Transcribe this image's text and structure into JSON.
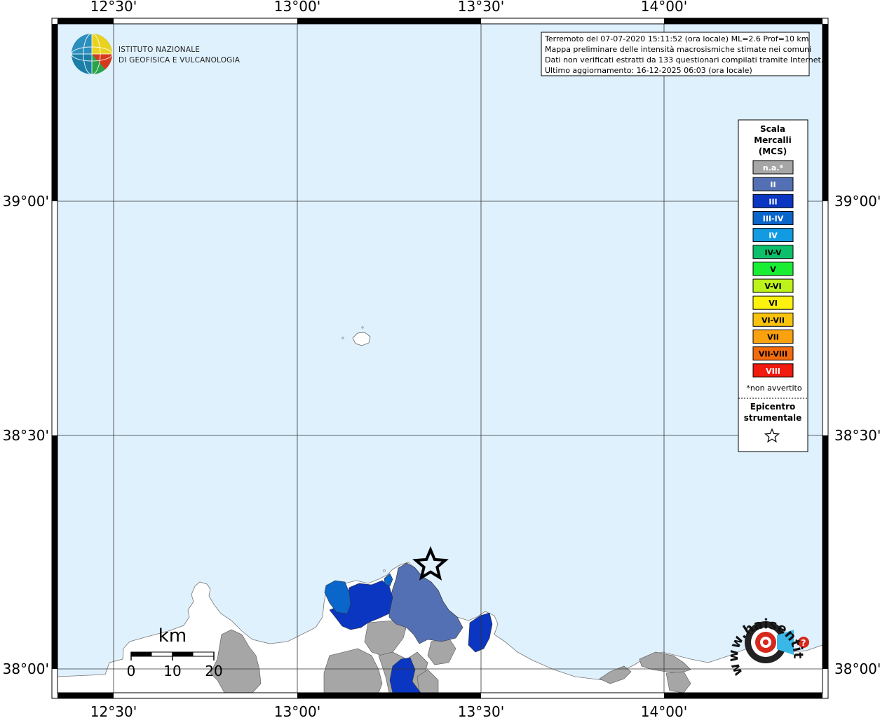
{
  "axes": {
    "top_ticks": [
      "12°30'",
      "13°00'",
      "13°30'",
      "14°00'"
    ],
    "bottom_ticks": [
      "12°30'",
      "13°00'",
      "13°30'",
      "14°00'"
    ],
    "left_ticks": [
      "39°00'",
      "38°30'",
      "38°00'"
    ],
    "right_ticks": [
      "39°00'",
      "38°30'",
      "38°00'"
    ]
  },
  "logo": {
    "line1": "ISTITUTO NAZIONALE",
    "line2": "DI GEOFISICA E VULCANOLOGIA"
  },
  "info_box": {
    "lines": [
      "Terremoto del 07-07-2020 15:11:52 (ora locale) ML=2.6 Prof=10 km",
      "Mappa preliminare delle intensità macrosismiche stimate nei comuni",
      "Dati non verificati estratti da 133 questionari compilati tramite Internet.",
      "Ultimo aggiornamento: 16-12-2025 06:03 (ora locale)"
    ]
  },
  "legend": {
    "title": [
      "Scala",
      "Mercalli",
      "(MCS)"
    ],
    "items": [
      {
        "label": "n.a.*",
        "color": "#a6a6a6",
        "text_color": "#ffffff"
      },
      {
        "label": "II",
        "color": "#5470b4",
        "text_color": "#ffffff"
      },
      {
        "label": "III",
        "color": "#0a36c2",
        "text_color": "#ffffff"
      },
      {
        "label": "III-IV",
        "color": "#0b66cc",
        "text_color": "#ffffff"
      },
      {
        "label": "IV",
        "color": "#129ae3",
        "text_color": "#ffffff"
      },
      {
        "label": "IV-V",
        "color": "#0cbf6a",
        "text_color": "#000000"
      },
      {
        "label": "V",
        "color": "#19ee33",
        "text_color": "#000000"
      },
      {
        "label": "V-VI",
        "color": "#bdf21a",
        "text_color": "#000000"
      },
      {
        "label": "VI",
        "color": "#fbf20e",
        "text_color": "#000000"
      },
      {
        "label": "VI-VII",
        "color": "#f8c30d",
        "text_color": "#000000"
      },
      {
        "label": "VII",
        "color": "#f9a10e",
        "text_color": "#000000"
      },
      {
        "label": "VII-VIII",
        "color": "#f36b0c",
        "text_color": "#000000"
      },
      {
        "label": "VIII",
        "color": "#f2190e",
        "text_color": "#ffffff"
      }
    ],
    "note": "*non avvertito",
    "epicenter_title": [
      "Epicentro",
      "strumentale"
    ]
  },
  "scale_bar": {
    "unit": "km",
    "labels": [
      "0",
      "10",
      "20"
    ]
  },
  "watermark": {
    "text": "www.haisentitoilterremoto.it"
  },
  "colors": {
    "sea": "#dff1fd",
    "land": "#ffffff",
    "na": "#a6a6a6",
    "II": "#5470b4",
    "III": "#0a36c2",
    "III-IV": "#0b66cc"
  }
}
